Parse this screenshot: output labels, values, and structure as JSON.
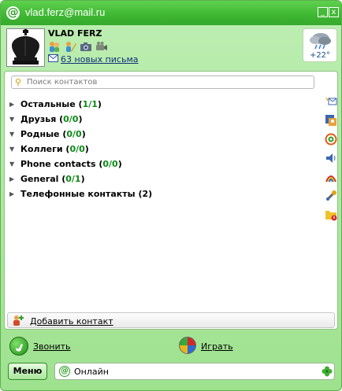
{
  "window": {
    "title": "vlad.ferz@mail.ru",
    "minimize_label": "_",
    "close_label": "x"
  },
  "profile": {
    "nickname": "VLAD FERZ",
    "mail_link": "63 новых письма",
    "weather_temp": "+22°"
  },
  "search": {
    "placeholder": "Поиск контактов"
  },
  "groups": [
    {
      "name": "Остальные",
      "count": "1/1",
      "expanded": false
    },
    {
      "name": "Друзья",
      "count": "0/0",
      "expanded": true
    },
    {
      "name": "Родные",
      "count": "0/0",
      "expanded": true
    },
    {
      "name": "Коллеги",
      "count": "0/0",
      "expanded": true
    },
    {
      "name": "Phone contacts",
      "count": "0/0",
      "expanded": true
    },
    {
      "name": "General",
      "count": "0/1",
      "expanded": false
    },
    {
      "name": "Телефонные контакты",
      "count": "2",
      "expanded": false
    }
  ],
  "add_contact_label": "Добавить контакт",
  "actions": {
    "call_label": "Звонить",
    "play_label": "Играть"
  },
  "statusbar": {
    "menu_label": "Меню",
    "status_text": "Онлайн"
  },
  "colors": {
    "accent": "#3eb733",
    "count_green": "#0a8a16",
    "link": "#11307a"
  }
}
